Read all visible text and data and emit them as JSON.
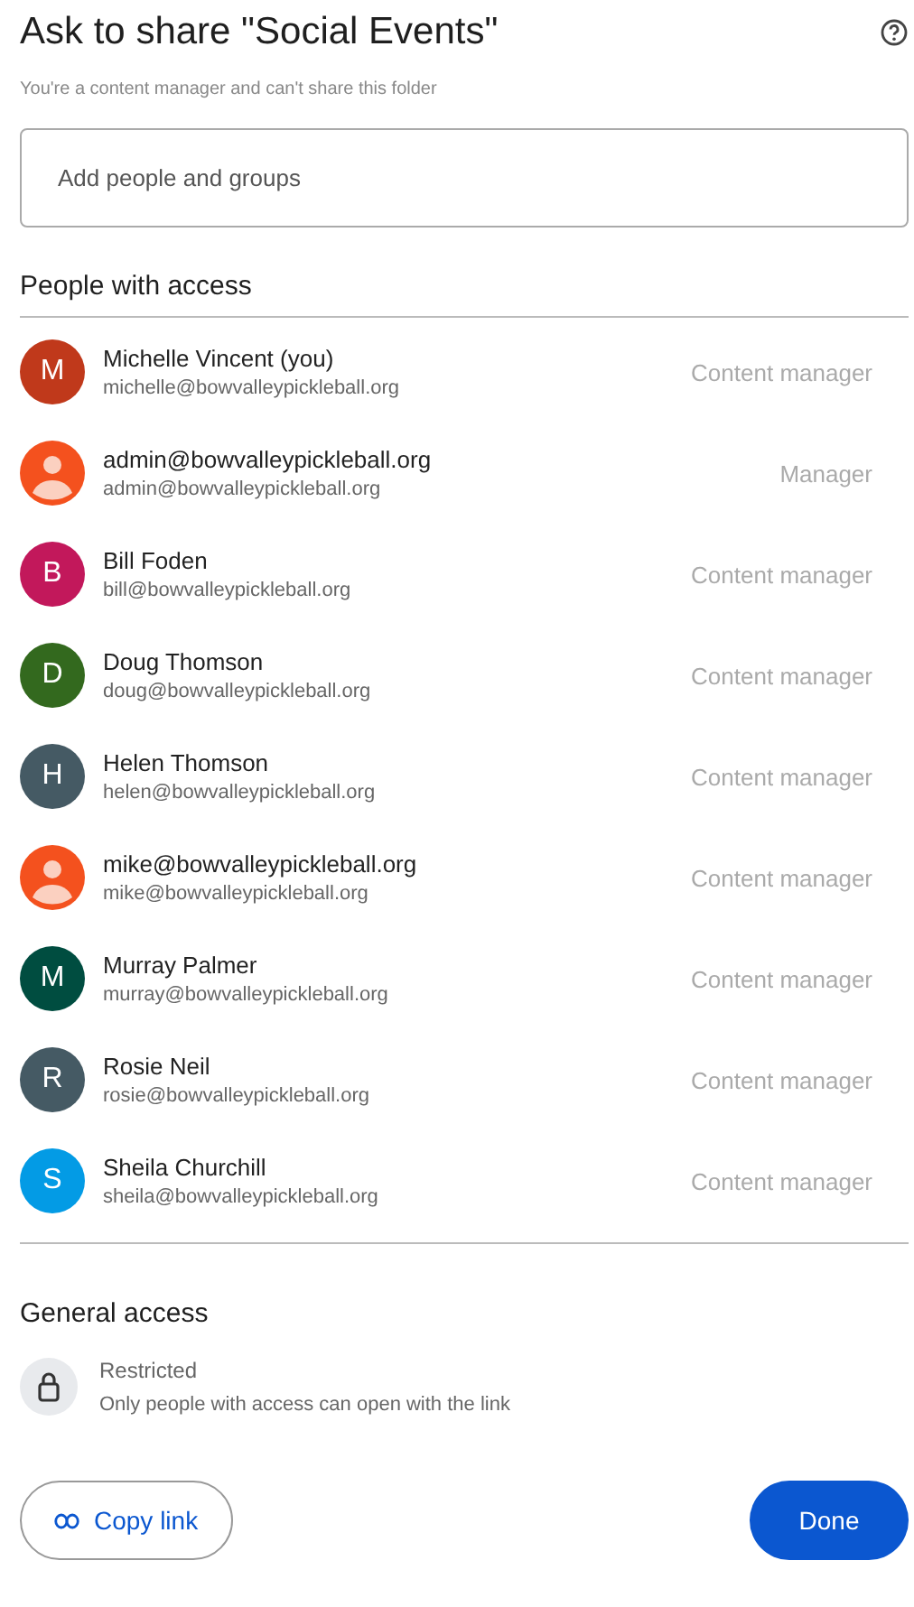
{
  "dialog": {
    "title": "Ask to share \"Social Events\"",
    "subtitle": "You're a content manager and can't share this folder"
  },
  "add_field": {
    "placeholder": "Add people and groups"
  },
  "people_section": {
    "heading": "People with access"
  },
  "people": [
    {
      "name": "Michelle Vincent (you)",
      "email": "michelle@bowvalleypickleball.org",
      "role": "Content manager",
      "avatar": {
        "kind": "initial",
        "letter": "M",
        "color": "#c0391b"
      }
    },
    {
      "name": "admin@bowvalleypickleball.org",
      "email": "admin@bowvalleypickleball.org",
      "role": "Manager",
      "avatar": {
        "kind": "person",
        "color": "#f4511e"
      }
    },
    {
      "name": "Bill Foden",
      "email": "bill@bowvalleypickleball.org",
      "role": "Content manager",
      "avatar": {
        "kind": "initial",
        "letter": "B",
        "color": "#c2185b"
      }
    },
    {
      "name": "Doug Thomson",
      "email": "doug@bowvalleypickleball.org",
      "role": "Content manager",
      "avatar": {
        "kind": "initial",
        "letter": "D",
        "color": "#33691e"
      }
    },
    {
      "name": "Helen Thomson",
      "email": "helen@bowvalleypickleball.org",
      "role": "Content manager",
      "avatar": {
        "kind": "initial",
        "letter": "H",
        "color": "#455a64"
      }
    },
    {
      "name": "mike@bowvalleypickleball.org",
      "email": "mike@bowvalleypickleball.org",
      "role": "Content manager",
      "avatar": {
        "kind": "person",
        "color": "#f4511e"
      }
    },
    {
      "name": "Murray Palmer",
      "email": "murray@bowvalleypickleball.org",
      "role": "Content manager",
      "avatar": {
        "kind": "initial",
        "letter": "M",
        "color": "#004d40"
      }
    },
    {
      "name": "Rosie Neil",
      "email": "rosie@bowvalleypickleball.org",
      "role": "Content manager",
      "avatar": {
        "kind": "initial",
        "letter": "R",
        "color": "#455a64"
      }
    },
    {
      "name": "Sheila Churchill",
      "email": "sheila@bowvalleypickleball.org",
      "role": "Content manager",
      "avatar": {
        "kind": "initial",
        "letter": "S",
        "color": "#039be5"
      }
    }
  ],
  "general_access": {
    "heading": "General access",
    "setting": "Restricted",
    "description": "Only people with access can open with the link"
  },
  "buttons": {
    "copy_link": "Copy link",
    "done": "Done"
  }
}
